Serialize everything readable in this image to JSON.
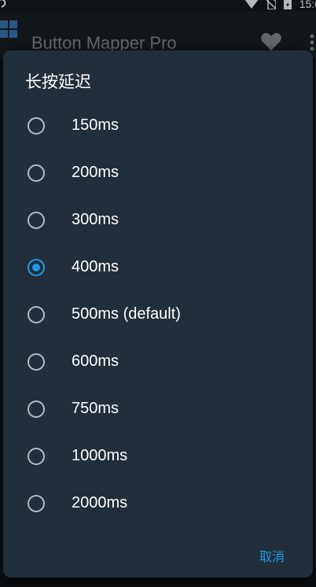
{
  "status_bar": {
    "time": "15:0"
  },
  "background_app": {
    "title": "Button Mapper Pro"
  },
  "dialog": {
    "title": "长按延迟",
    "options": [
      {
        "label": "150ms",
        "selected": false
      },
      {
        "label": "200ms",
        "selected": false
      },
      {
        "label": "300ms",
        "selected": false
      },
      {
        "label": "400ms",
        "selected": true
      },
      {
        "label": "500ms (default)",
        "selected": false
      },
      {
        "label": "600ms",
        "selected": false
      },
      {
        "label": "750ms",
        "selected": false
      },
      {
        "label": "1000ms",
        "selected": false
      },
      {
        "label": "2000ms",
        "selected": false
      }
    ],
    "cancel_label": "取消"
  },
  "colors": {
    "accent": "#1e9be6",
    "dialog_background": "#222e39",
    "text_primary": "#ffffff"
  },
  "icons": [
    "wifi-icon",
    "no-sim-icon",
    "battery-charging-icon",
    "app-launcher-icon",
    "heart-icon",
    "more-vert-icon"
  ]
}
